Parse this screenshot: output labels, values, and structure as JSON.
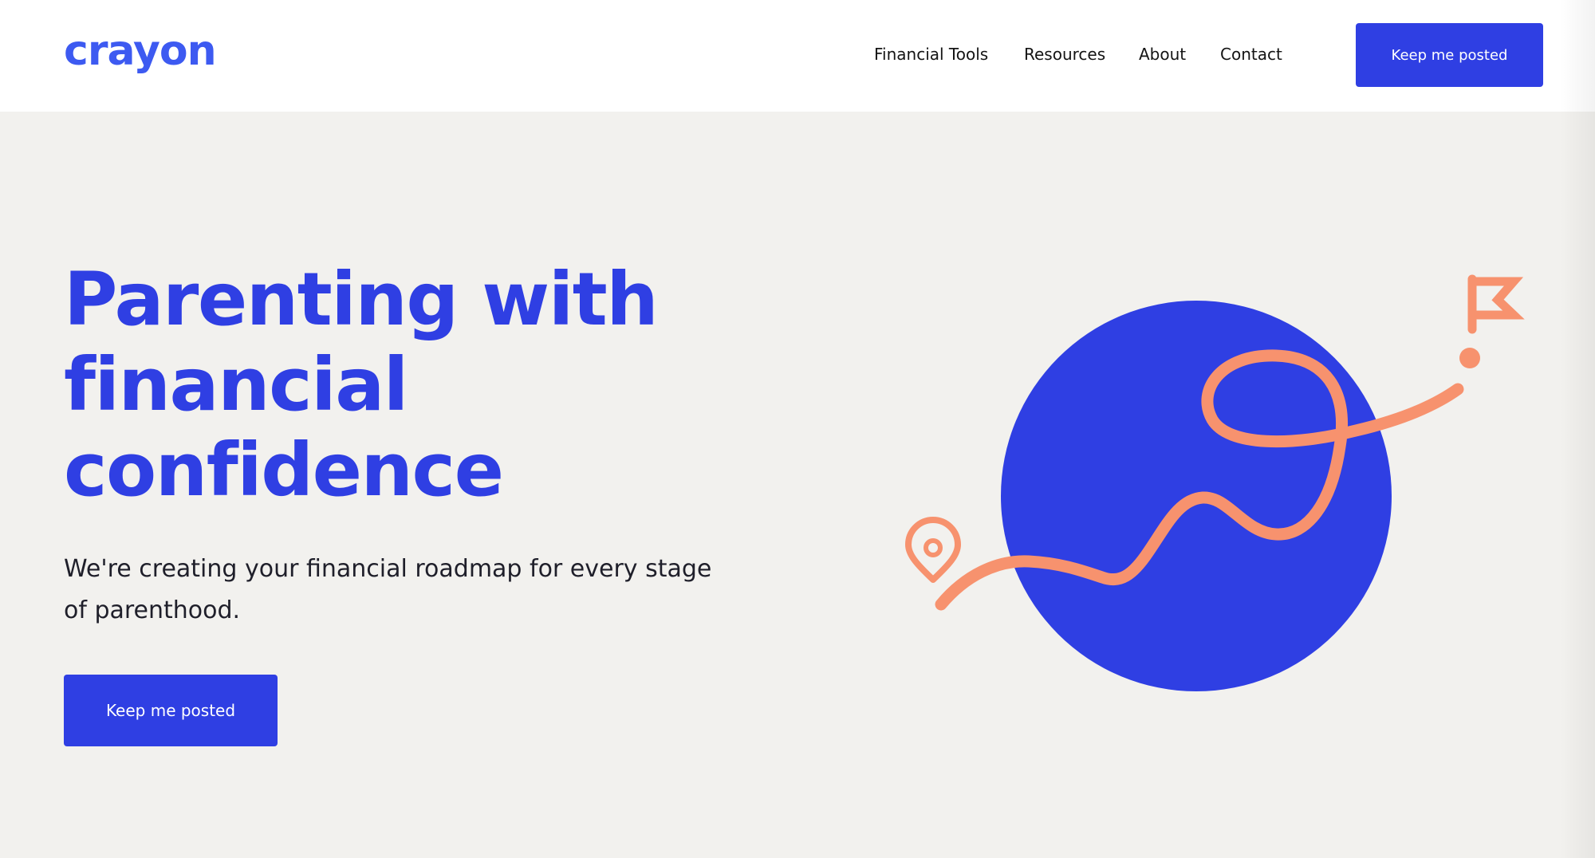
{
  "header": {
    "logo_text": "crayon",
    "nav": {
      "financial_tools": "Financial Tools",
      "resources": "Resources",
      "about": "About",
      "contact": "Contact"
    },
    "cta_label": "Keep me posted"
  },
  "hero": {
    "title_line1": "Parenting with",
    "title_line2": "financial",
    "title_line3": "confidence",
    "subtitle": "We're creating your financial roadmap for every stage of parenthood.",
    "cta_label": "Keep me posted"
  },
  "colors": {
    "brand_blue": "#2f3fe3",
    "logo_blue": "#3d5af1",
    "accent_orange": "#f7926e",
    "background": "#f2f1ee",
    "header_bg": "#ffffff"
  },
  "icons": {
    "illustration": "roadmap-planet-illustration",
    "start": "location-pin-icon",
    "end": "flag-icon"
  }
}
